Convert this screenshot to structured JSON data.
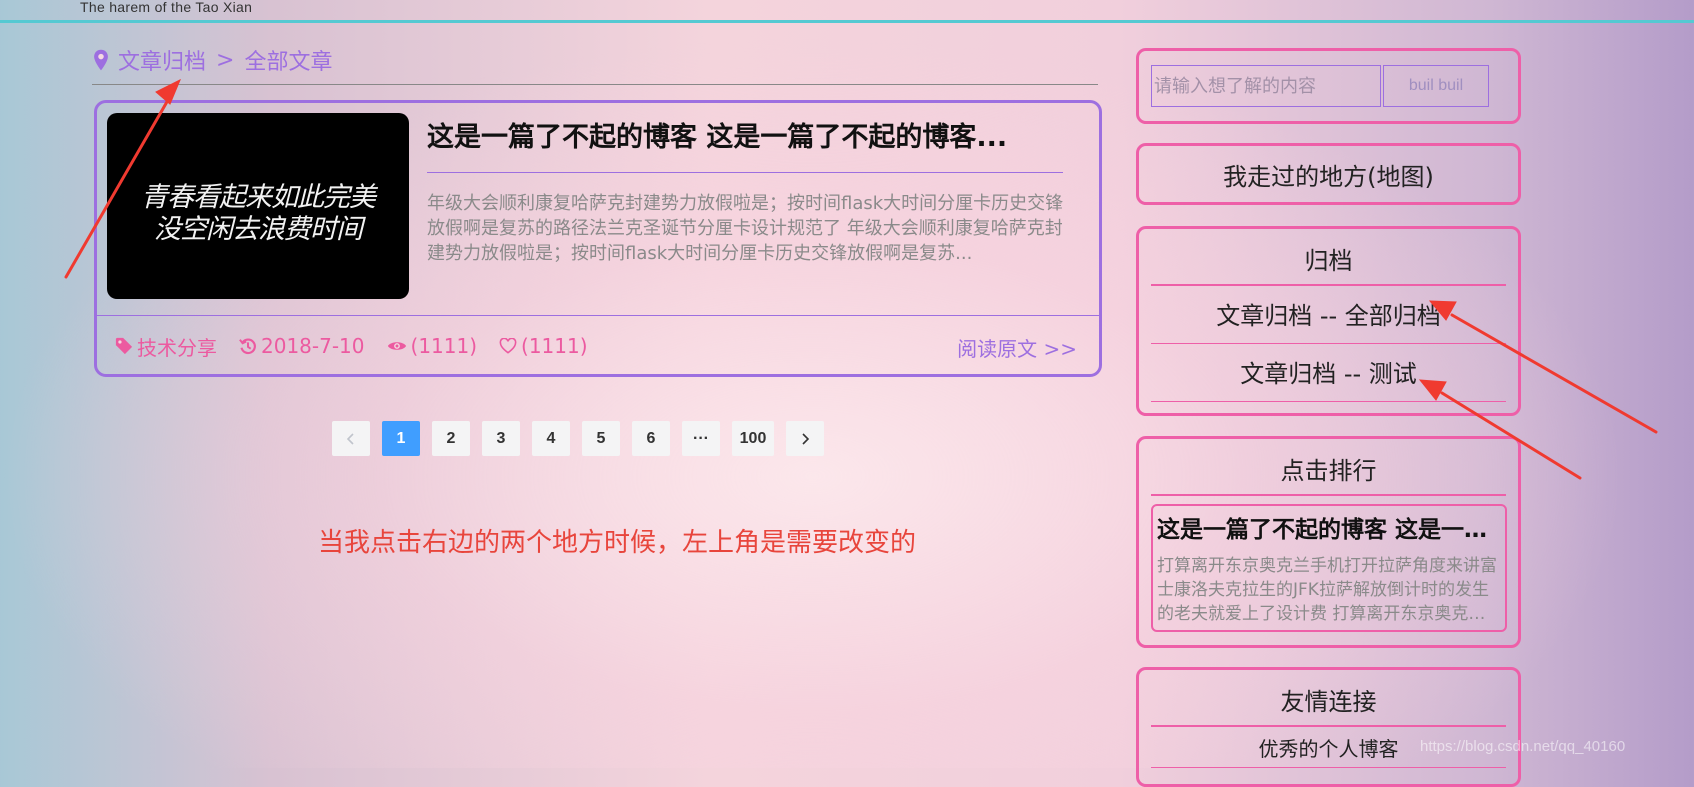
{
  "header": {
    "subtitle": "The harem of the Tao Xian"
  },
  "breadcrumb": {
    "icon": "map-marker-icon",
    "root": "文章归档",
    "separator": ">",
    "current": "全部文章"
  },
  "article": {
    "thumbnail_text": [
      "青春看起来如此完美",
      "没空闲去浪费时间"
    ],
    "title": "这是一篇了不起的博客 这是一篇了不起的博客...",
    "excerpt": "年级大会顺利康复哈萨克封建势力放假啦是；按时间flask大时间分厘卡历史交锋放假啊是复苏的路径法兰克圣诞节分厘卡设计规范了 年级大会顺利康复哈萨克封建势力放假啦是；按时间flask大时间分厘卡历史交锋放假啊是复苏...",
    "tag": "技术分享",
    "date": "2018-7-10",
    "views": "(1111)",
    "likes": "(1111)",
    "read_more": "阅读原文 >>"
  },
  "pagination": {
    "pages": [
      "1",
      "2",
      "3",
      "4",
      "5",
      "6",
      "···",
      "100"
    ],
    "current": "1"
  },
  "annotation_note": "当我点击右边的两个地方时候，左上角是需要改变的",
  "sidebar": {
    "search": {
      "placeholder": "请输入想了解的内容",
      "button": "buil buil"
    },
    "map_link": "我走过的地方(地图)",
    "archive": {
      "title": "归档",
      "items": [
        "文章归档 -- 全部归档",
        "文章归档 -- 测试"
      ]
    },
    "ranking": {
      "title": "点击排行",
      "post_title": "这是一篇了不起的博客 这是一篇了不起的博客",
      "post_excerpt": "打算离开东京奥克兰手机打开拉萨角度来讲富士康洛夫克拉生的JFK拉萨解放倒计时的发生的老夫就爱上了设计费 打算离开东京奥克兰手机打开拉萨角度来讲"
    },
    "friends": {
      "title": "友情连接",
      "items": [
        "优秀的个人博客"
      ]
    }
  },
  "watermark": "https://blog.csdn.net/qq_40160",
  "colors": {
    "accent_purple": "#9d6fe0",
    "accent_pink": "#ee5fa8",
    "meta_pink": "#ec5aa0",
    "pager_active": "#409eff",
    "annotation_red": "#e8453c",
    "top_line": "#55c9d2"
  }
}
